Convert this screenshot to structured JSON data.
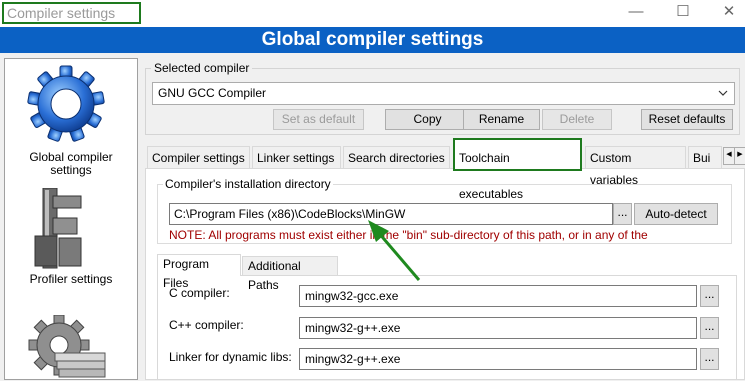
{
  "window": {
    "title": "Compiler settings",
    "minimize_glyph": "—",
    "maximize_glyph": "☐",
    "close_glyph": "✕"
  },
  "header": {
    "title": "Global compiler settings"
  },
  "nav": {
    "items": [
      {
        "label_line1": "Global compiler",
        "label_line2": "settings",
        "icon": "gear-icon",
        "selected": true
      },
      {
        "label_line1": "Profiler settings",
        "label_line2": "",
        "icon": "caliper-icon",
        "selected": false
      },
      {
        "label_line1": "",
        "label_line2": "",
        "icon": "gear-stack-icon",
        "selected": false
      }
    ]
  },
  "selected_compiler": {
    "group_label": "Selected compiler",
    "value": "GNU GCC Compiler",
    "buttons": {
      "set_default": "Set as default",
      "copy": "Copy",
      "rename": "Rename",
      "delete": "Delete",
      "reset_defaults": "Reset defaults"
    }
  },
  "tabs": [
    {
      "label": "Compiler settings"
    },
    {
      "label": "Linker settings"
    },
    {
      "label": "Search directories"
    },
    {
      "label": "Toolchain executables",
      "active": true
    },
    {
      "label": "Custom variables"
    },
    {
      "label": "Bui"
    }
  ],
  "tab_scroll": {
    "left": "◀",
    "right": "▶"
  },
  "installation": {
    "group_label": "Compiler's installation directory",
    "path": "C:\\Program Files (x86)\\CodeBlocks\\MinGW",
    "browse_label": "...",
    "auto_detect_label": "Auto-detect",
    "note": "NOTE: All programs must exist either in the \"bin\" sub-directory of this path, or in any of the"
  },
  "subtabs": [
    {
      "label": "Program Files",
      "active": true
    },
    {
      "label": "Additional Paths"
    }
  ],
  "programs": [
    {
      "label": "C compiler:",
      "value": "mingw32-gcc.exe",
      "browse": "..."
    },
    {
      "label": "C++ compiler:",
      "value": "mingw32-g++.exe",
      "browse": "..."
    },
    {
      "label": "Linker for dynamic libs:",
      "value": "mingw32-g++.exe",
      "browse": "..."
    }
  ],
  "colors": {
    "header_bg": "#0b61c4",
    "highlight_box": "#1e7a1e",
    "note_text": "#a00000",
    "annotation_arrow": "#1f8a1f"
  }
}
